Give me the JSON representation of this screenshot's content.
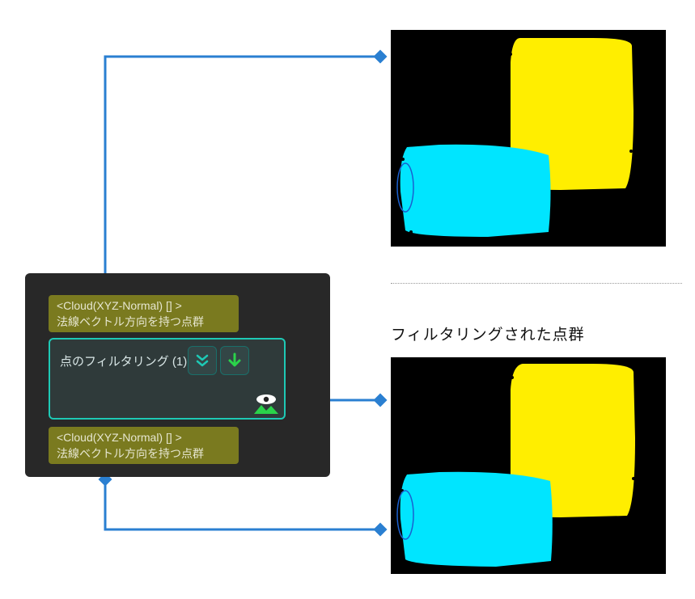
{
  "node": {
    "input_port": {
      "type_label": "<Cloud(XYZ-Normal) [] >",
      "desc_label": "法線ベクトル方向を持つ点群"
    },
    "output_port": {
      "type_label": "<Cloud(XYZ-Normal) [] >",
      "desc_label": "法線ベクトル方向を持つ点群"
    },
    "title": "点のフィルタリング (1)",
    "button_expand_name": "expand-button",
    "button_run_name": "run-button",
    "viewer_name": "viewer-icon"
  },
  "right": {
    "heading": "フィルタリングされた点群"
  },
  "colors": {
    "connector": "#2a7fd1",
    "diamond_fill": "#2a7fd1",
    "node_border": "#1ec9b5"
  }
}
